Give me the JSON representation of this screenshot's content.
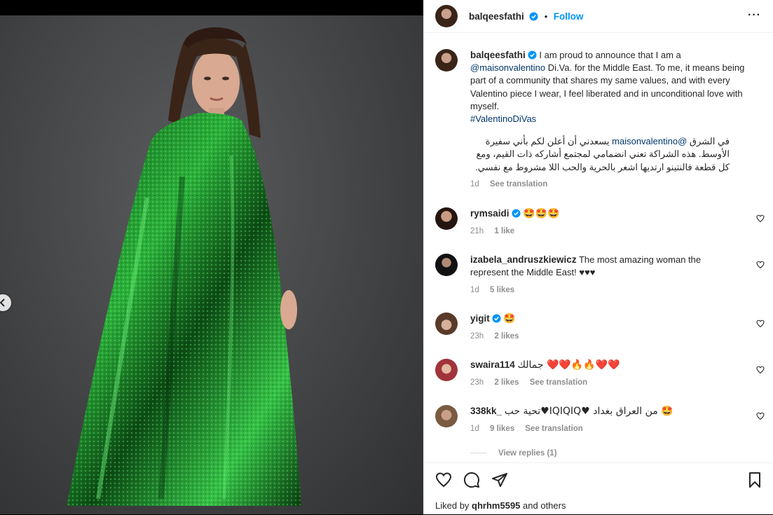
{
  "post": {
    "author": "balqeesfathi",
    "follow_label": "Follow",
    "more_label": "···"
  },
  "caption": {
    "author": "balqeesfathi",
    "text_1": " I am proud to announce that I am a ",
    "mention": "@maisonvalentino",
    "text_2": " Di.Va. for the Middle East. To me, it means being part of a community that shares my same values, and with every Valentino piece I wear, I feel liberated and in unconditional love with myself.",
    "hashtag": "#ValentinoDiVas",
    "arabic_1": "في الشرق ",
    "arabic_mention": "@maisonvalentino",
    "arabic_2": " يسعدني أن أعلن لكم بأني سفيرة الأوسط. هذه الشراكة تعني انضمامي لمجتمع أشاركه ذات القيم، ومع كل قطعة فالنتينو ارتديها اشعر بالحرية والحب اللا مشروط مع نفسي.",
    "time": "1d",
    "see_translation": "See translation"
  },
  "comments": [
    {
      "user": "rymsaidi",
      "verified": true,
      "text": "🤩🤩🤩",
      "time": "21h",
      "likes": "1 like",
      "translation": ""
    },
    {
      "user": "izabela_andruszkiewicz",
      "verified": false,
      "text": "The most amazing woman the represent the Middle East! ♥♥♥",
      "time": "1d",
      "likes": "5 likes",
      "translation": ""
    },
    {
      "user": "yigit",
      "verified": true,
      "text": "🤩",
      "time": "23h",
      "likes": "2 likes",
      "translation": ""
    },
    {
      "user": "swaira114",
      "verified": false,
      "text": "جمالك ❤️❤️🔥🔥❤️❤️",
      "time": "23h",
      "likes": "2 likes",
      "translation": "See translation"
    },
    {
      "user": "338kk_",
      "verified": false,
      "text": "تحية حب♥IQIQIQ♥ من العراق بغداد 🤩",
      "time": "1d",
      "likes": "9 likes",
      "translation": "See translation"
    }
  ],
  "view_replies": "View replies (1)",
  "liked_by": {
    "prefix": "Liked by ",
    "user": "qhrhm5595",
    "suffix": " and others"
  },
  "icons": {
    "like": "heart-icon",
    "comment": "comment-icon",
    "share": "send-icon",
    "save": "bookmark-icon",
    "prev": "chevron-left-icon",
    "verified": "verified-badge-icon"
  },
  "colors": {
    "accent": "#0095f6",
    "verified": "#0095f6",
    "dress": "#1f8a2a"
  }
}
